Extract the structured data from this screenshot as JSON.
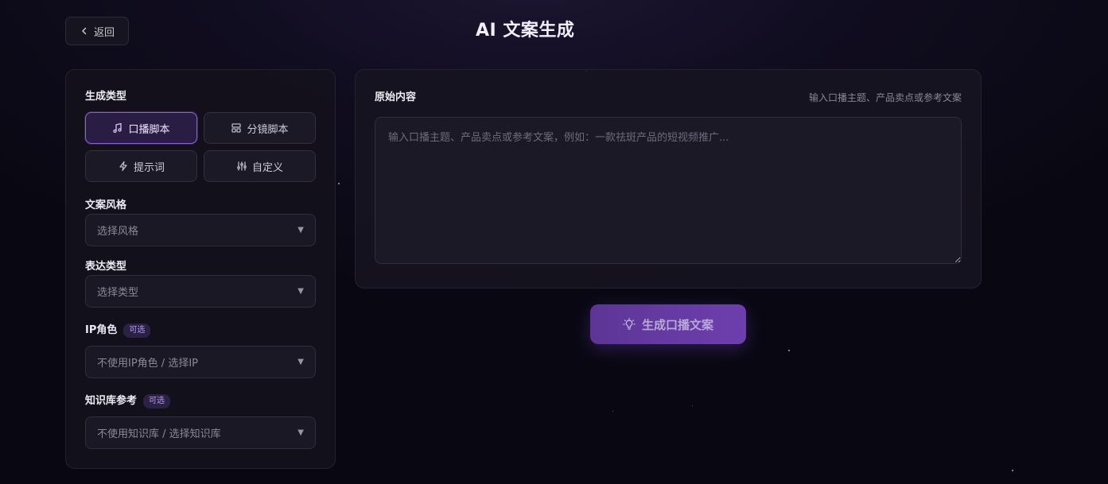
{
  "header": {
    "back_label": "返回",
    "title": "AI 文案生成"
  },
  "generation_type": {
    "label": "生成类型",
    "options": [
      {
        "label": "口播脚本",
        "icon": "music-note-icon",
        "active": true
      },
      {
        "label": "分镜脚本",
        "icon": "storyboard-icon",
        "active": false
      },
      {
        "label": "提示词",
        "icon": "lightning-icon",
        "active": false
      },
      {
        "label": "自定义",
        "icon": "sliders-icon",
        "active": false
      }
    ]
  },
  "style": {
    "label": "文案风格",
    "placeholder": "选择风格"
  },
  "expression": {
    "label": "表达类型",
    "placeholder": "选择类型"
  },
  "ip_role": {
    "label": "IP角色",
    "badge": "可选",
    "placeholder": "不使用IP角色 / 选择IP"
  },
  "knowledge": {
    "label": "知识库参考",
    "badge": "可选",
    "placeholder": "不使用知识库 / 选择知识库"
  },
  "content": {
    "label": "原始内容",
    "hint": "输入口播主题、产品卖点或参考文案",
    "placeholder": "输入口播主题、产品卖点或参考文案，例如：一款祛斑产品的短视频推广..."
  },
  "generate": {
    "label": "生成口播文案",
    "icon": "lightbulb-icon"
  },
  "colors": {
    "accent": "#8d5fe0",
    "button_gradient_start": "#5d3596",
    "button_gradient_end": "#6d3fae",
    "background": "#0b0a14"
  }
}
